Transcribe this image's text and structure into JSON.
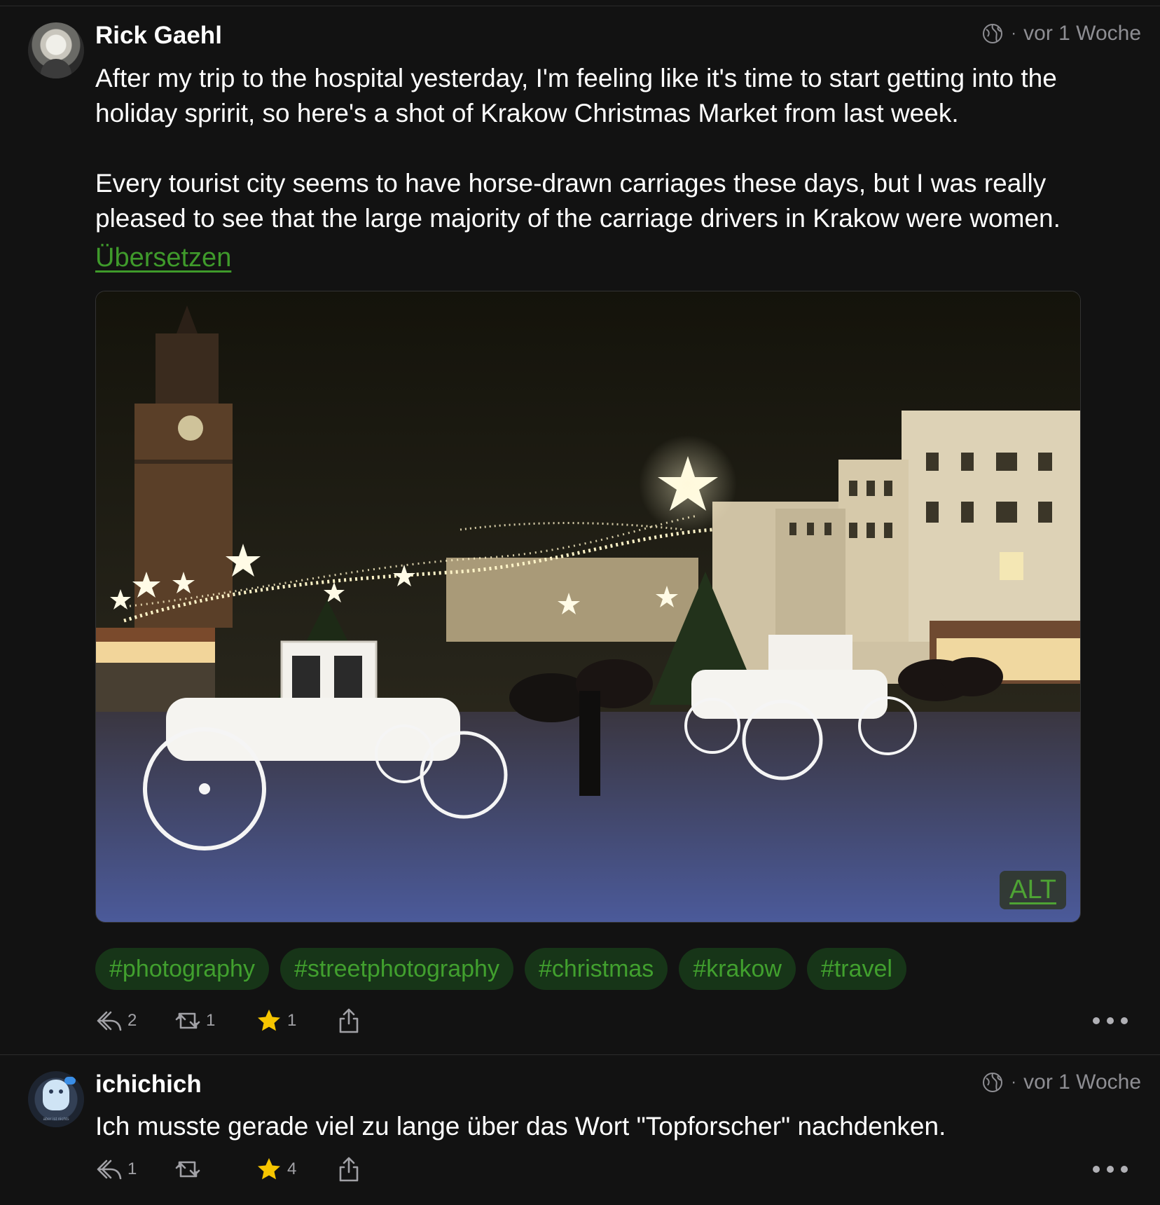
{
  "posts": [
    {
      "author": "Rick Gaehl",
      "visibility_icon": "globe-icon",
      "separator": "·",
      "time": "vor 1 Woche",
      "paragraphs": [
        "After my trip to the hospital yesterday, I'm feeling like it's time to start getting into the holiday spririt, so here's a shot of Krakow Christmas Market from last week.",
        "Every tourist city seems to have horse-drawn carriages these days, but I was really pleased to see that the large majority of the carriage drivers in Krakow were women."
      ],
      "translate_label": "Übersetzen",
      "media": {
        "alt_badge": "ALT",
        "badge_color": "#4ea334"
      },
      "tags": [
        "#photography",
        "#streetphotography",
        "#christmas",
        "#krakow",
        "#travel"
      ],
      "actions": {
        "reply_count": "2",
        "boost_count": "1",
        "favourite_count": "1"
      }
    },
    {
      "author": "ichichich",
      "avatar_caption": "aber ist nichts",
      "visibility_icon": "globe-icon",
      "separator": "·",
      "time": "vor 1 Woche",
      "paragraphs": [
        "Ich musste gerade viel zu lange über das Wort \"Topforscher\" nachdenken."
      ],
      "actions": {
        "reply_count": "1",
        "boost_count": "",
        "favourite_count": "4"
      }
    }
  ],
  "colors": {
    "background": "#121212",
    "accent_green": "#3f9a2b",
    "tag_background": "#173518",
    "star_yellow": "#f6c500",
    "muted_text": "#8e8e93"
  }
}
